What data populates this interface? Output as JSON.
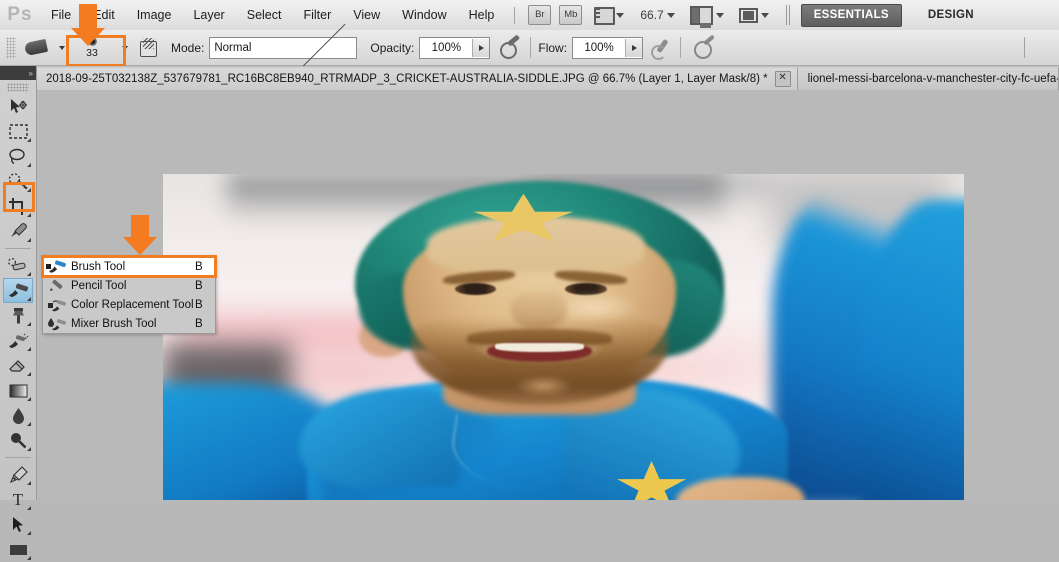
{
  "app": {
    "logo": "Ps"
  },
  "menubar": {
    "items": [
      "File",
      "Edit",
      "Image",
      "Layer",
      "Select",
      "Filter",
      "View",
      "Window",
      "Help"
    ],
    "bridge_label": "Br",
    "minibridge_label": "Mb",
    "zoom_value": "66.7",
    "workspaces": [
      {
        "label": "ESSENTIALS",
        "active": true
      },
      {
        "label": "DESIGN",
        "active": false
      }
    ]
  },
  "options_bar": {
    "brush_size": "33",
    "mode_label": "Mode:",
    "mode_value": "Normal",
    "opacity_label": "Opacity:",
    "opacity_value": "100%",
    "flow_label": "Flow:",
    "flow_value": "100%"
  },
  "tabs": [
    {
      "title": "2018-09-25T032138Z_537679781_RC16BC8EB940_RTRMADP_3_CRICKET-AUSTRALIA-SIDDLE.JPG @ 66.7% (Layer 1, Layer Mask/8) *",
      "close": "✕",
      "active": true
    },
    {
      "title": "lionel-messi-barcelona-v-manchester-city-fc-uefa-champi",
      "close": "",
      "active": false
    }
  ],
  "toolbar": {
    "expand_glyph": "»",
    "tools": [
      {
        "name": "move-tool"
      },
      {
        "name": "rectangular-marquee-tool"
      },
      {
        "name": "lasso-tool"
      },
      {
        "name": "quick-selection-tool"
      },
      {
        "name": "crop-tool"
      },
      {
        "name": "eyedropper-tool"
      },
      {
        "name": "spot-healing-brush-tool"
      },
      {
        "name": "brush-tool"
      },
      {
        "name": "clone-stamp-tool"
      },
      {
        "name": "history-brush-tool"
      },
      {
        "name": "eraser-tool"
      },
      {
        "name": "gradient-tool"
      },
      {
        "name": "blur-tool"
      },
      {
        "name": "dodge-tool"
      },
      {
        "name": "pen-tool"
      },
      {
        "name": "horizontal-type-tool"
      },
      {
        "name": "path-selection-tool"
      },
      {
        "name": "rectangle-tool"
      }
    ]
  },
  "flyout": {
    "items": [
      {
        "label": "Brush Tool",
        "shortcut": "B",
        "active": true
      },
      {
        "label": "Pencil Tool",
        "shortcut": "B",
        "active": false
      },
      {
        "label": "Color Replacement Tool",
        "shortcut": "B",
        "active": false
      },
      {
        "label": "Mixer Brush Tool",
        "shortcut": "B",
        "active": false
      }
    ]
  },
  "annotations": {
    "accent_color": "#f47b20",
    "arrow_brush_size": "points-to-brush-size-box",
    "arrow_brush_tool": "points-to-brush-tool-flyout-item"
  },
  "canvas": {
    "document_background": "#f2efed",
    "workspace_background": "#b9b9b9"
  }
}
